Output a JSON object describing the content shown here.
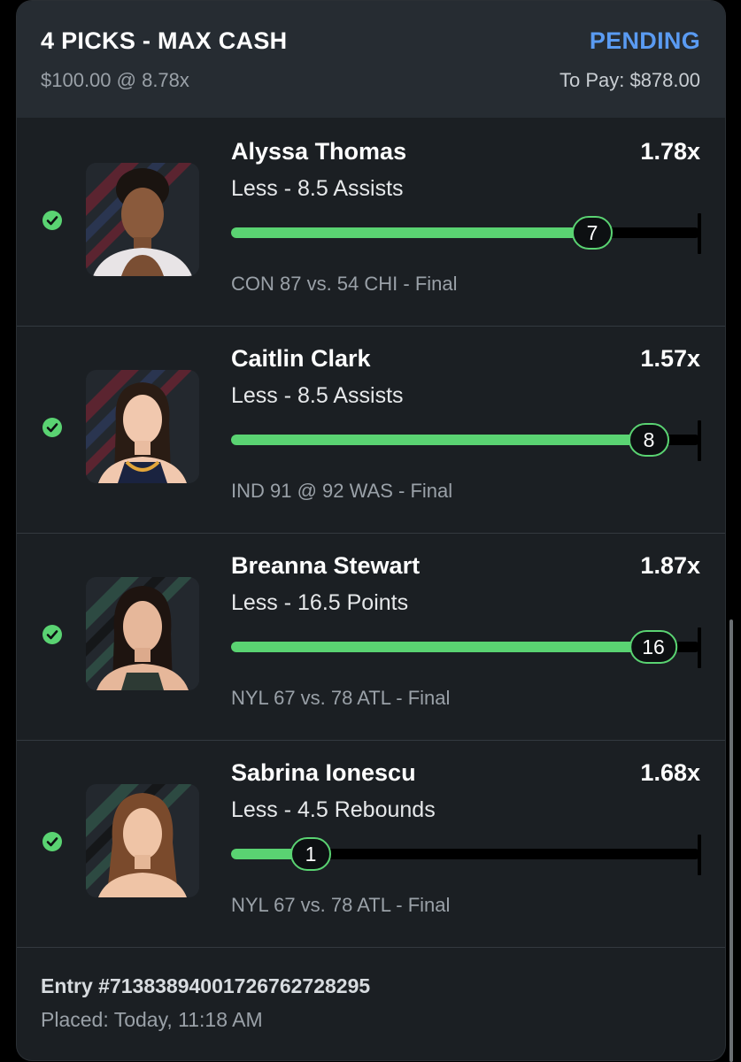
{
  "header": {
    "title": "4 PICKS - MAX CASH",
    "status": "PENDING",
    "stake": "$100.00 @ 8.78x",
    "to_pay": "To Pay: $878.00"
  },
  "colors": {
    "accent_green": "#5ad372",
    "status_blue": "#5a9bf2",
    "card_bg": "#1b1f23",
    "header_bg": "#262c32"
  },
  "picks": [
    {
      "player": "Alyssa Thomas",
      "multiplier": "1.78x",
      "line": "Less - 8.5 Assists",
      "actual": "7",
      "progress_fraction": 0.77,
      "game": "CON 87 vs. 54 CHI  - Final",
      "result_icon": "check-circle-icon"
    },
    {
      "player": "Caitlin Clark",
      "multiplier": "1.57x",
      "line": "Less - 8.5 Assists",
      "actual": "8",
      "progress_fraction": 0.89,
      "game": "IND 91 @ 92 WAS  - Final",
      "result_icon": "check-circle-icon"
    },
    {
      "player": "Breanna Stewart",
      "multiplier": "1.87x",
      "line": "Less - 16.5 Points",
      "actual": "16",
      "progress_fraction": 0.9,
      "game": "NYL 67 vs. 78 ATL  - Final",
      "result_icon": "check-circle-icon"
    },
    {
      "player": "Sabrina Ionescu",
      "multiplier": "1.68x",
      "line": "Less - 4.5 Rebounds",
      "actual": "1",
      "progress_fraction": 0.17,
      "game": "NYL 67 vs. 78 ATL  - Final",
      "result_icon": "check-circle-icon"
    }
  ],
  "footer": {
    "entry": "Entry #713838940017267627282​95",
    "placed": "Placed: Today, 11:18 AM"
  }
}
